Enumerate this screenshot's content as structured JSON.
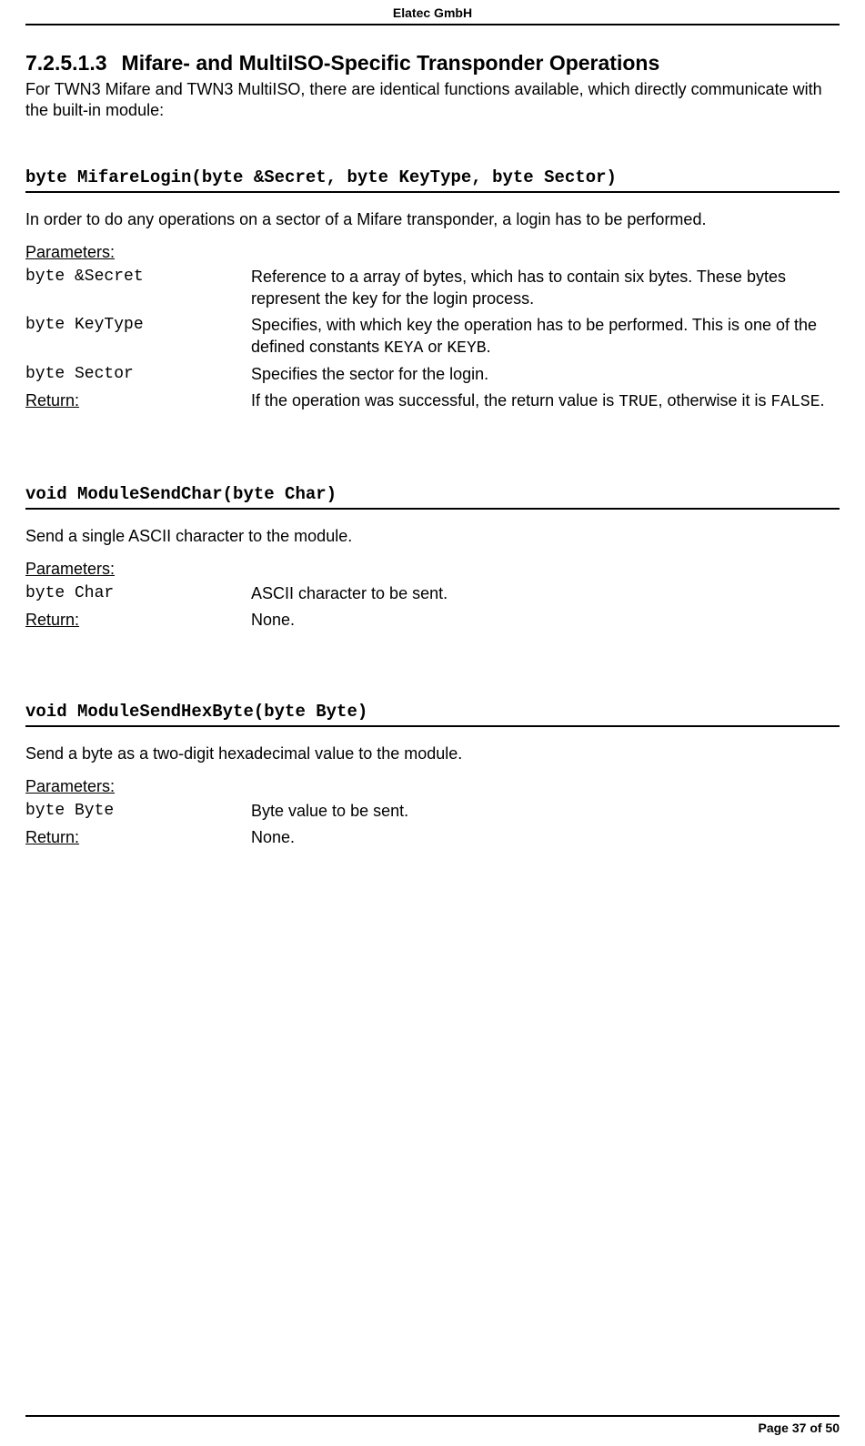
{
  "header": {
    "company": "Elatec GmbH"
  },
  "section": {
    "number": "7.2.5.1.3",
    "title": "Mifare- and MultiISO-Specific Transponder Operations",
    "intro": "For TWN3 Mifare and TWN3 MultiISO, there are identical functions available, which directly communicate with the built-in module:"
  },
  "fn1": {
    "sig": "byte MifareLogin(byte &Secret, byte KeyType, byte Sector)",
    "desc": "In order to do any operations on a sector of a Mifare transponder, a login has to be performed.",
    "params_label": "Parameters:",
    "p1": {
      "name": "byte &Secret",
      "desc": "Reference to a array of bytes, which has to contain six bytes. These bytes represent the key for the login process."
    },
    "p2": {
      "name": "byte KeyType",
      "desc_a": "Specifies, with which key the operation has to be performed. This is one of the defined constants ",
      "code_a": "KEYA",
      "desc_b": " or ",
      "code_b": "KEYB",
      "desc_c": "."
    },
    "p3": {
      "name": "byte Sector",
      "desc": "Specifies the sector for the login."
    },
    "return_label": "Return:",
    "return": {
      "desc_a": "If the operation was successful, the return value is ",
      "code_a": "TRUE",
      "desc_b": ", otherwise it is ",
      "code_b": "FALSE",
      "desc_c": "."
    }
  },
  "fn2": {
    "sig": "void ModuleSendChar(byte Char)",
    "desc": "Send a single ASCII character to the module.",
    "params_label": "Parameters:",
    "p1": {
      "name": "byte Char",
      "desc": "ASCII character to be sent."
    },
    "return_label": "Return:",
    "return_desc": "None."
  },
  "fn3": {
    "sig": "void ModuleSendHexByte(byte Byte)",
    "desc": "Send a byte as a two-digit hexadecimal value to the module.",
    "params_label": "Parameters:",
    "p1": {
      "name": "byte Byte",
      "desc": "Byte value to be sent."
    },
    "return_label": "Return:",
    "return_desc": "None."
  },
  "footer": {
    "page": "Page 37 of 50"
  }
}
